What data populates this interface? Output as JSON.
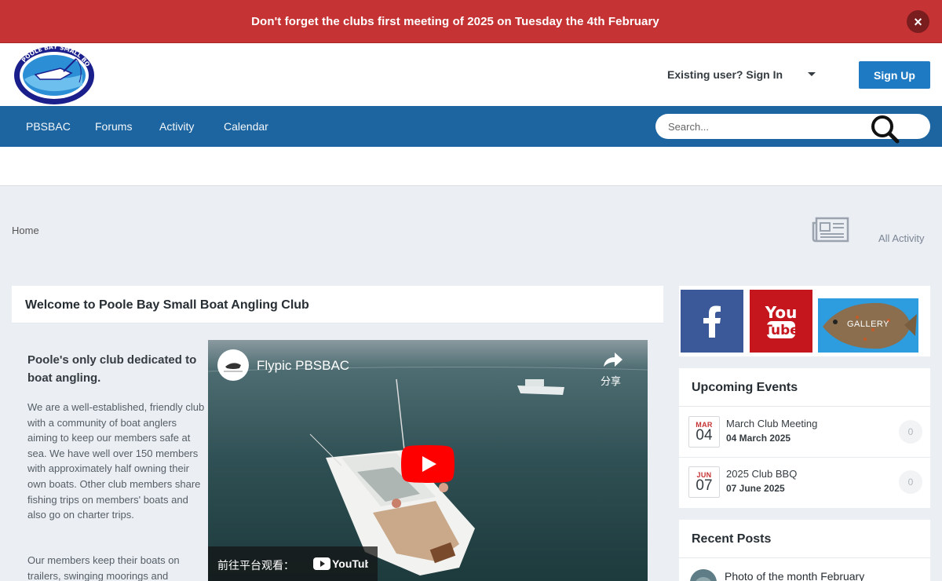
{
  "announcement": {
    "text": "Don't forget the clubs first meeting of 2025 on Tuesday the 4th February",
    "close_glyph": "×"
  },
  "header": {
    "logo_icon": "club-logo-icon",
    "signin_label": "Existing user? Sign In",
    "signup_label": "Sign Up"
  },
  "nav": {
    "items": [
      {
        "label": "PBSBAC"
      },
      {
        "label": "Forums"
      },
      {
        "label": "Activity"
      },
      {
        "label": "Calendar"
      }
    ],
    "search_placeholder": "Search..."
  },
  "breadcrumb": {
    "home": "Home",
    "all_activity": "All Activity"
  },
  "main": {
    "title": "Welcome to Poole Bay Small Boat Angling Club",
    "intro_heading": "Poole's only club dedicated to boat angling.",
    "paragraphs": [
      "We are a well-established, friendly club with a community of boat anglers aiming to keep our members safe at sea. We have well over 150 members with approximately half owning their own boats. Other club members share fishing trips on members' boats and also go on charter trips.",
      "Our members keep their boats on trailers, swinging moorings and"
    ],
    "video": {
      "title": "Flypic PBSBAC",
      "share_label": "分享",
      "watch_label": "前往平台观看：",
      "platform": "YouTube"
    }
  },
  "sidebar": {
    "social": {
      "facebook_icon": "facebook-icon",
      "youtube_icon": "youtube-icon",
      "gallery_label": "GALLERY"
    },
    "upcoming_events": {
      "title": "Upcoming Events",
      "events": [
        {
          "month": "MAR",
          "day": "04",
          "name": "March Club Meeting",
          "date": "04 March 2025",
          "count": "0"
        },
        {
          "month": "JUN",
          "day": "07",
          "name": "2025 Club BBQ",
          "date": "07 June 2025",
          "count": "0"
        }
      ]
    },
    "recent_posts": {
      "title": "Recent Posts",
      "first_post": "Photo of the month February"
    }
  },
  "colors": {
    "announcement_bg": "#c63334",
    "nav_bg": "#1d65a0",
    "signup_bg": "#1e7ac3",
    "page_bg": "#ebeef3"
  }
}
